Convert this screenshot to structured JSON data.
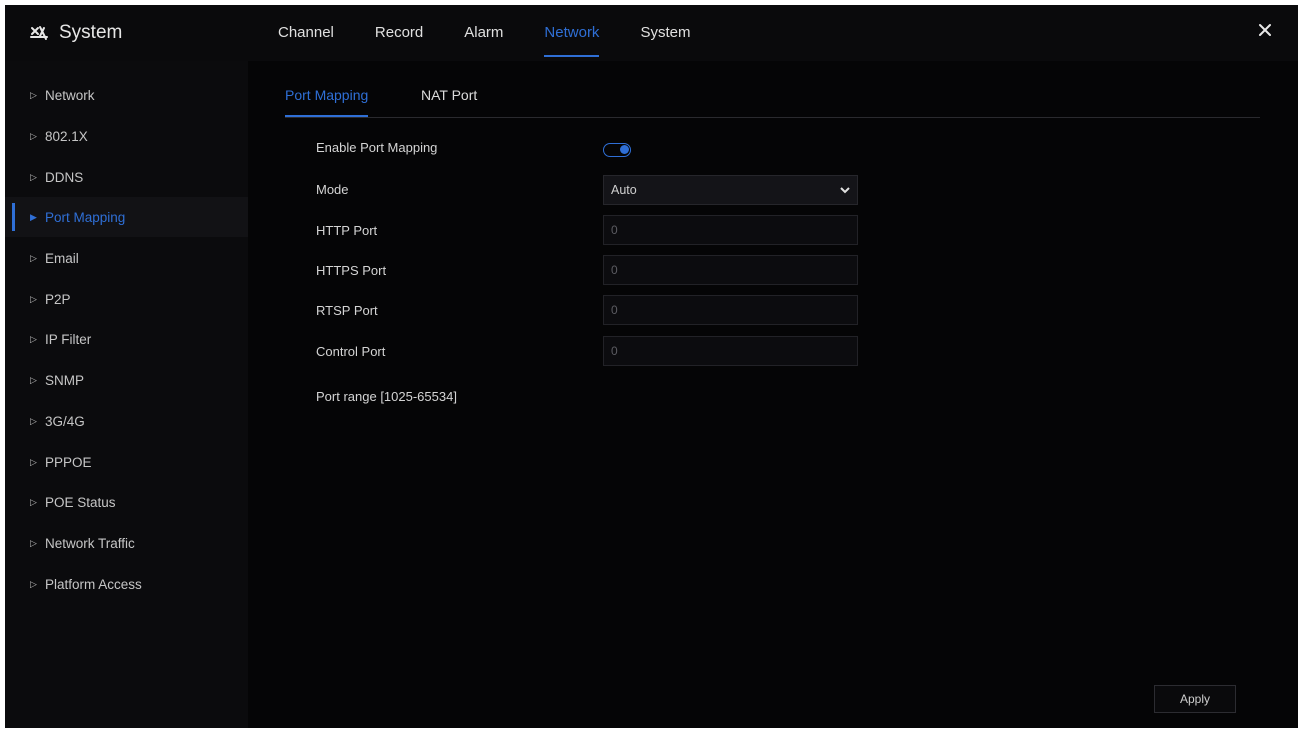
{
  "app": {
    "title": "System"
  },
  "top_tabs": [
    {
      "label": "Channel"
    },
    {
      "label": "Record"
    },
    {
      "label": "Alarm"
    },
    {
      "label": "Network",
      "active": true
    },
    {
      "label": "System"
    }
  ],
  "sidebar": {
    "items": [
      {
        "label": "Network"
      },
      {
        "label": "802.1X"
      },
      {
        "label": "DDNS"
      },
      {
        "label": "Port Mapping",
        "active": true
      },
      {
        "label": "Email"
      },
      {
        "label": "P2P"
      },
      {
        "label": "IP Filter"
      },
      {
        "label": "SNMP"
      },
      {
        "label": "3G/4G"
      },
      {
        "label": "PPPOE"
      },
      {
        "label": "POE Status"
      },
      {
        "label": "Network Traffic"
      },
      {
        "label": "Platform Access"
      }
    ]
  },
  "subtabs": [
    {
      "label": "Port Mapping",
      "active": true
    },
    {
      "label": "NAT Port"
    }
  ],
  "form": {
    "enable_label": "Enable Port Mapping",
    "enable_value": true,
    "mode_label": "Mode",
    "mode_value": "Auto",
    "http_label": "HTTP Port",
    "http_value": "0",
    "https_label": "HTTPS Port",
    "https_value": "0",
    "rtsp_label": "RTSP Port",
    "rtsp_value": "0",
    "control_label": "Control Port",
    "control_value": "0",
    "port_range": "Port range [1025-65534]"
  },
  "apply_label": "Apply",
  "colors": {
    "accent": "#2f6fd6",
    "background": "#050506"
  }
}
